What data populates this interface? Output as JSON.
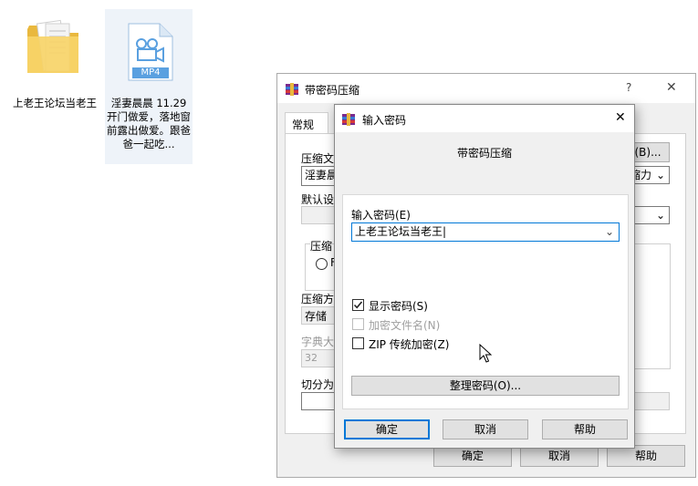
{
  "desktop": {
    "folder_label": "上老王论坛当老王",
    "video_badge": "MP4",
    "video_label": "淫妻晨晨 11.29 开门做爱，落地窗前露出做爱。跟爸爸一起吃..."
  },
  "back_dialog": {
    "title": "带密码压缩",
    "help_glyph": "?",
    "close_glyph": "✕",
    "tab_general": "常规",
    "label_archive": "压缩文",
    "archive_value": "淫妻晨",
    "browse_button": "(B)...",
    "dropdown_suffix": "缩力",
    "label_default": "默认设",
    "group_label": "压缩",
    "radio_label": "F",
    "label_method": "压缩方",
    "method_value": "存储",
    "label_dict": "字典大",
    "dict_value": "32",
    "label_split": "切分为",
    "ok_button": "确定",
    "cancel_button": "取消",
    "help_button": "帮助"
  },
  "front_dialog": {
    "title": "输入密码",
    "close_glyph": "✕",
    "subtitle": "带密码压缩",
    "password_label": "输入密码(E)",
    "password_value": "上老王论坛当老王",
    "show_password": "显示密码(S)",
    "show_password_checked": true,
    "encrypt_names": "加密文件名(N)",
    "encrypt_names_enabled": false,
    "zip_legacy": "ZIP 传统加密(Z)",
    "zip_legacy_checked": false,
    "organize_button": "整理密码(O)...",
    "ok_button": "确定",
    "cancel_button": "取消",
    "help_button": "帮助"
  },
  "colors": {
    "accent": "#0078d7",
    "folder": "#f7d468",
    "video": "#5aa0e0"
  }
}
